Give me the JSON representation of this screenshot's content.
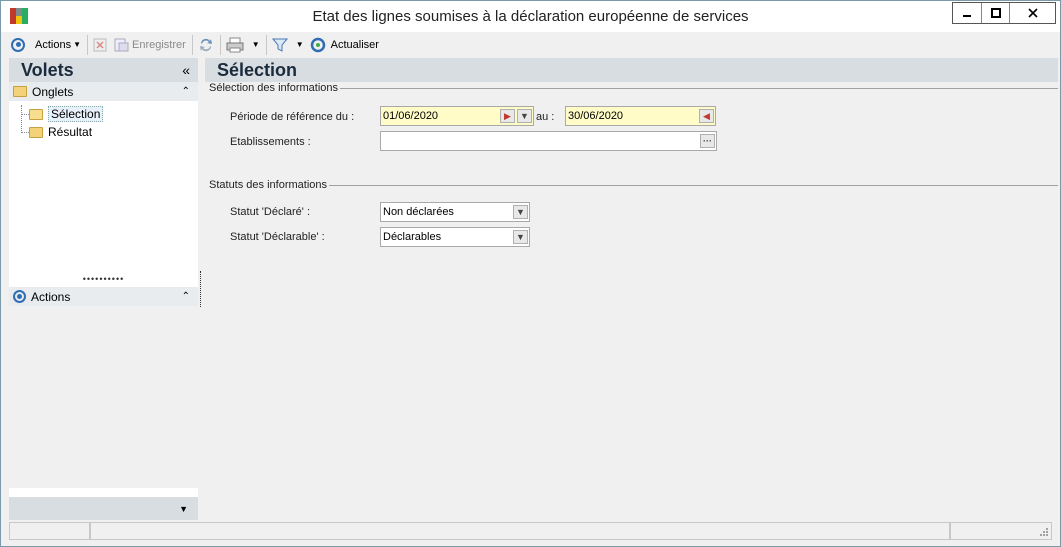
{
  "window": {
    "title": "Etat des lignes soumises à la déclaration européenne de services"
  },
  "toolbar": {
    "actions_label": "Actions",
    "save_label": "Enregistrer",
    "refresh_label": "Actualiser"
  },
  "left_pane": {
    "title": "Volets",
    "collapse_glyph": "«",
    "tabs_group": {
      "label": "Onglets",
      "items": [
        {
          "label": "Sélection"
        },
        {
          "label": "Résultat"
        }
      ]
    },
    "actions_group": {
      "label": "Actions"
    }
  },
  "main": {
    "title": "Sélection",
    "section_info": "Sélection des informations",
    "period_label": "Période de référence du :",
    "date_from": "01/06/2020",
    "au_label": "au :",
    "date_to": "30/06/2020",
    "establishments_label": "Etablissements :",
    "establishments_value": "",
    "section_status": "Statuts des informations",
    "status_declared_label": "Statut 'Déclaré' :",
    "status_declared_value": "Non déclarées",
    "status_declarable_label": "Statut 'Déclarable' :",
    "status_declarable_value": "Déclarables"
  },
  "colors": {
    "accent": "#2f6db5",
    "date_field_bg": "#fffcc8",
    "header_bg": "#d8dde2"
  }
}
